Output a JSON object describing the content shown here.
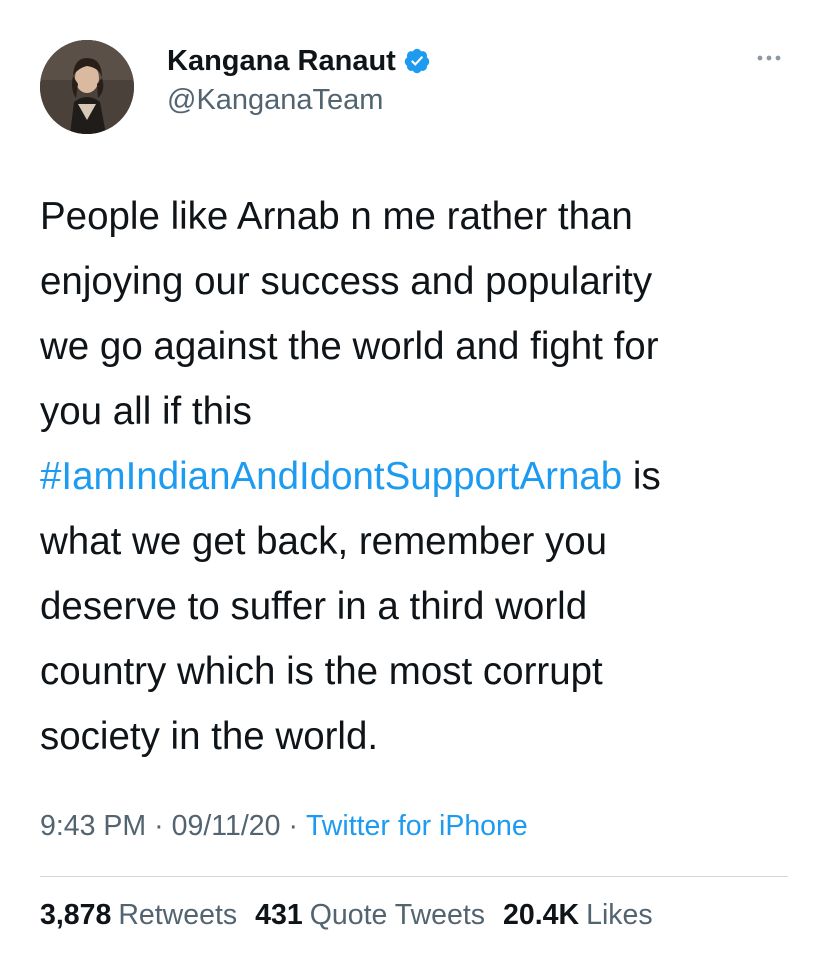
{
  "tweet": {
    "author": {
      "display_name": "Kangana Ranaut",
      "handle": "@KanganaTeam",
      "verified": true
    },
    "text_lines": {
      "l1": "People like Arnab n me rather than",
      "l2": "enjoying our success and popularity",
      "l3": "we go against the world and fight for",
      "l4": "you all if this",
      "l5_hashtag": "#IamIndianAndIdontSupportArnab",
      "l5_rest": " is",
      "l6": "what we get back, remember you",
      "l7": "deserve to suffer in a third world",
      "l8": "country which is the most corrupt",
      "l9": "society in the world."
    },
    "meta": {
      "time": "9:43 PM",
      "separator": "·",
      "date": "09/11/20",
      "source": "Twitter for iPhone"
    },
    "stats": {
      "retweets_count": "3,878",
      "retweets_label": "Retweets",
      "quotes_count": "431",
      "quotes_label": "Quote Tweets",
      "likes_count": "20.4K",
      "likes_label": "Likes"
    }
  },
  "colors": {
    "link": "#1d9bf0",
    "secondary_text": "#536471",
    "primary_text": "#0f1419",
    "divider": "#cfd9de"
  },
  "icons": {
    "verified": "verified-badge-icon",
    "more": "more-options-icon"
  }
}
